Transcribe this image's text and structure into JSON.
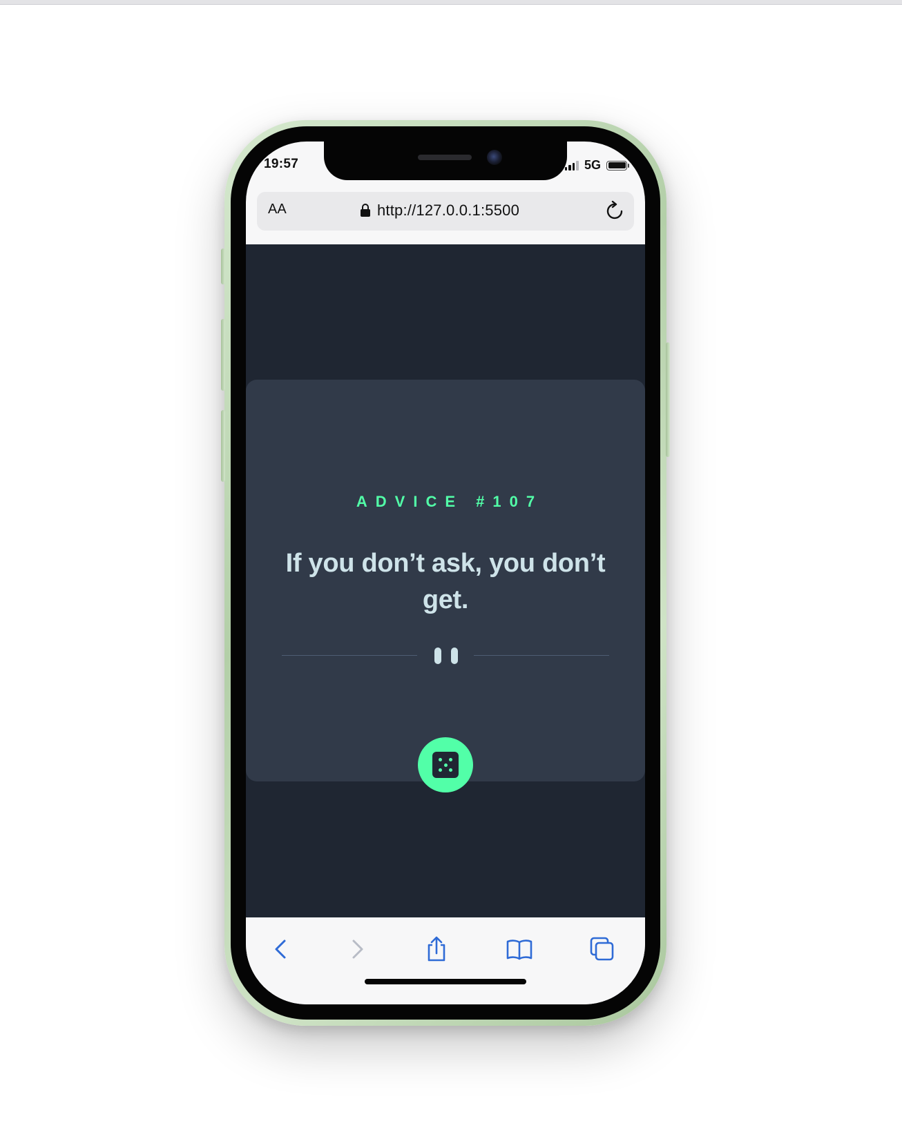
{
  "status_bar": {
    "time": "19:57",
    "network": "5G"
  },
  "browser": {
    "text_size_label": "AA",
    "url": "http://127.0.0.1:5500"
  },
  "advice_card": {
    "advice_id": "ADVICE #107",
    "quote": "If you don’t ask, you don’t get."
  },
  "colors": {
    "accent": "#52ffa8",
    "page_background": "#1f2632",
    "card_background": "#313a49",
    "quote_text": "#cee3e9",
    "toolbar_icon": "#2f6bd6",
    "phone_frame": "#b9d3ae"
  },
  "icons": {
    "lock": "lock-icon",
    "reload": "reload-icon",
    "divider": "pause-icon",
    "dice": "dice-icon",
    "back": "chevron-left-icon",
    "forward": "chevron-right-icon",
    "share": "share-icon",
    "bookmarks": "book-icon",
    "tabs": "tabs-icon"
  }
}
